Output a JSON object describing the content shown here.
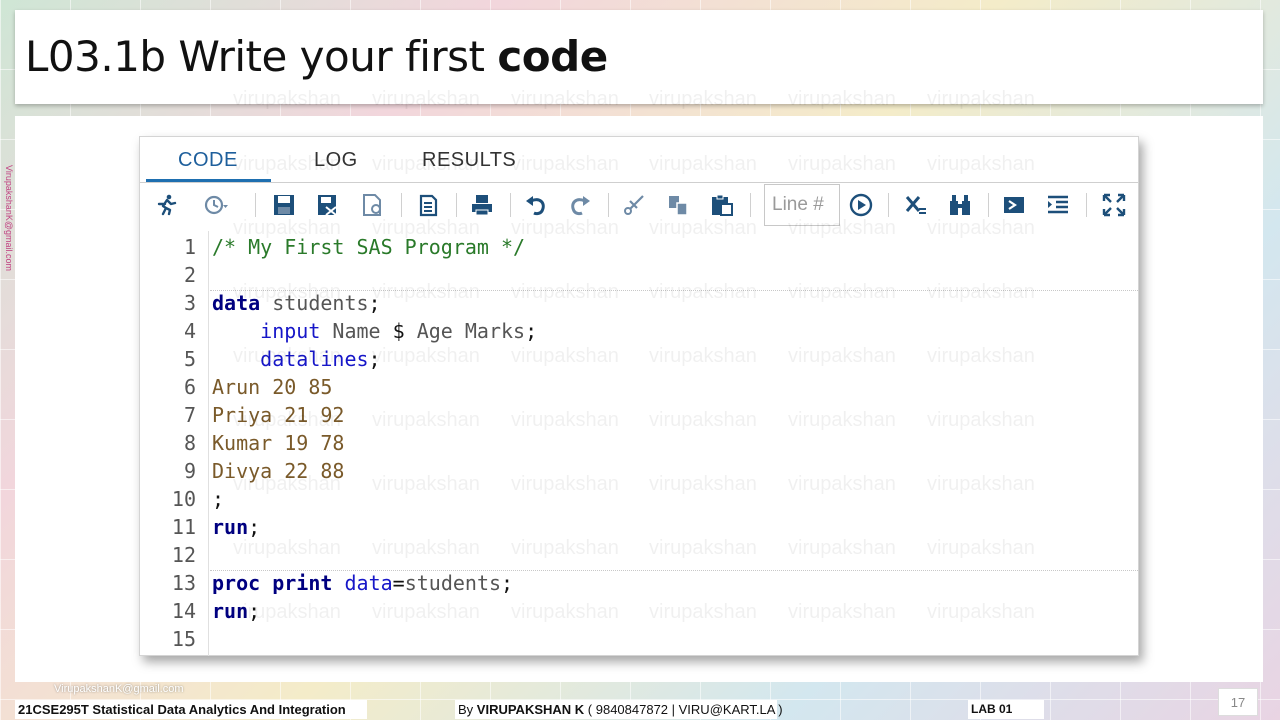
{
  "slide": {
    "title_prefix": "L03.1b Write your first ",
    "title_bold": "code",
    "side_email": "VirupakshanK@gmail.com",
    "page_number": "17"
  },
  "editor": {
    "tabs": [
      {
        "label": "CODE",
        "active": true
      },
      {
        "label": "LOG",
        "active": false
      },
      {
        "label": "RESULTS",
        "active": false
      }
    ],
    "toolbar": {
      "line_placeholder": "Line #",
      "icons": [
        "run-icon",
        "history-icon",
        "save-icon",
        "save-as-icon",
        "open-icon",
        "copy-program-icon",
        "print-icon",
        "undo-icon",
        "redo-icon",
        "cut-icon",
        "copy-icon",
        "paste-icon",
        "go-icon",
        "clear-icon",
        "find-icon",
        "indent-icon",
        "format-icon",
        "maximize-icon"
      ]
    },
    "code_lines": [
      {
        "n": "1",
        "parts": [
          {
            "t": "/* My First SAS Program */",
            "c": "c-comment"
          }
        ]
      },
      {
        "n": "2",
        "parts": []
      },
      {
        "n": "3",
        "parts": [
          {
            "t": "data",
            "c": "c-kw"
          },
          {
            "t": " students",
            "c": "c-plain"
          },
          {
            "t": ";",
            "c": "c-punct"
          }
        ]
      },
      {
        "n": "4",
        "parts": [
          {
            "t": "    ",
            "c": "c-plain"
          },
          {
            "t": "input",
            "c": "c-kw2"
          },
          {
            "t": " Name ",
            "c": "c-plain"
          },
          {
            "t": "$",
            "c": "c-punct"
          },
          {
            "t": " Age Marks",
            "c": "c-plain"
          },
          {
            "t": ";",
            "c": "c-punct"
          }
        ]
      },
      {
        "n": "5",
        "parts": [
          {
            "t": "    ",
            "c": "c-plain"
          },
          {
            "t": "datalines",
            "c": "c-kw2"
          },
          {
            "t": ";",
            "c": "c-punct"
          }
        ]
      },
      {
        "n": "6",
        "parts": [
          {
            "t": "Arun 20 85",
            "c": "c-data"
          }
        ]
      },
      {
        "n": "7",
        "parts": [
          {
            "t": "Priya 21 92",
            "c": "c-data"
          }
        ]
      },
      {
        "n": "8",
        "parts": [
          {
            "t": "Kumar 19 78",
            "c": "c-data"
          }
        ]
      },
      {
        "n": "9",
        "parts": [
          {
            "t": "Divya 22 88",
            "c": "c-data"
          }
        ]
      },
      {
        "n": "10",
        "parts": [
          {
            "t": ";",
            "c": "c-punct"
          }
        ]
      },
      {
        "n": "11",
        "parts": [
          {
            "t": "run",
            "c": "c-kw"
          },
          {
            "t": ";",
            "c": "c-punct"
          }
        ]
      },
      {
        "n": "12",
        "parts": []
      },
      {
        "n": "13",
        "parts": [
          {
            "t": "proc",
            "c": "c-kw"
          },
          {
            "t": " ",
            "c": "c-plain"
          },
          {
            "t": "print",
            "c": "c-kw"
          },
          {
            "t": " ",
            "c": "c-plain"
          },
          {
            "t": "data",
            "c": "c-kw2"
          },
          {
            "t": "=",
            "c": "c-punct"
          },
          {
            "t": "students",
            "c": "c-plain"
          },
          {
            "t": ";",
            "c": "c-punct"
          }
        ]
      },
      {
        "n": "14",
        "parts": [
          {
            "t": "run",
            "c": "c-kw"
          },
          {
            "t": ";",
            "c": "c-punct"
          }
        ]
      },
      {
        "n": "15",
        "parts": []
      }
    ]
  },
  "footer": {
    "email": "VirupakshanK@gmail.com",
    "course": "21CSE295T Statistical Data Analytics And Integration",
    "author_prefix": "By ",
    "author_name": "VIRUPAKSHAN K",
    "author_contact": " ( 9840847872 | VIRU@KART.LA )",
    "lab": "LAB  01"
  },
  "watermark_text": "virupakshan",
  "colors": {
    "accent": "#1e6fb0",
    "keyword": "#000080",
    "comment": "#2a7a2a",
    "data": "#7a5a2a"
  }
}
